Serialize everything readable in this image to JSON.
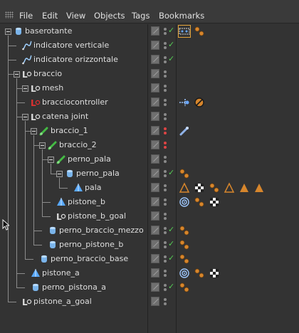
{
  "menubar": {
    "items": [
      {
        "id": "file",
        "label": "File"
      },
      {
        "id": "edit",
        "label": "Edit"
      },
      {
        "id": "view",
        "label": "View"
      },
      {
        "id": "objects",
        "label": "Objects"
      },
      {
        "id": "tags",
        "label": "Tags"
      },
      {
        "id": "bookmarks",
        "label": "Bookmarks"
      }
    ]
  },
  "objects": [
    {
      "name": "baserotante",
      "icon": "cylinder-icon",
      "tags": [
        "rig-tag-icon",
        "material-tag-icon"
      ]
    },
    {
      "name": "indicatore verticale",
      "icon": "spline-icon",
      "tags": []
    },
    {
      "name": "indicatore orizzontale",
      "icon": "spline-icon",
      "tags": []
    },
    {
      "name": "braccio",
      "icon": "null-icon",
      "tags": []
    },
    {
      "name": "mesh",
      "icon": "null-icon",
      "tags": []
    },
    {
      "name": "bracciocontroller",
      "icon": "null-controller-icon",
      "tags": [
        "constraint-tag-icon",
        "stop-tag-icon"
      ]
    },
    {
      "name": "catena joint",
      "icon": "null-icon",
      "tags": []
    },
    {
      "name": "braccio_1",
      "icon": "joint-icon",
      "tags": [
        "ik-tag-icon"
      ]
    },
    {
      "name": "braccio_2",
      "icon": "joint-icon",
      "tags": []
    },
    {
      "name": "perno_pala",
      "icon": "joint-icon",
      "tags": []
    },
    {
      "name": "perno_pala",
      "icon": "cylinder-icon",
      "tags": [
        "material-tag-icon"
      ]
    },
    {
      "name": "pala",
      "icon": "polygon-icon",
      "tags": [
        "phong-tag-icon",
        "checker-tag-icon",
        "material-tag-icon",
        "phong-tag-icon",
        "filled-triangle-tag-icon",
        "filled-triangle-tag-icon"
      ]
    },
    {
      "name": "pistone_b",
      "icon": "polygon-icon",
      "tags": [
        "target-tag-icon",
        "material-tag-icon",
        "checker-tag-icon"
      ]
    },
    {
      "name": "pistone_b_goal",
      "icon": "null-icon",
      "tags": []
    },
    {
      "name": "perno_braccio_mezzo",
      "icon": "cylinder-icon",
      "tags": [
        "material-tag-icon"
      ]
    },
    {
      "name": "perno_pistone_b",
      "icon": "cylinder-icon",
      "tags": [
        "material-tag-icon"
      ]
    },
    {
      "name": "perno_braccio_base",
      "icon": "cylinder-icon",
      "tags": [
        "material-tag-icon"
      ]
    },
    {
      "name": "pistone_a",
      "icon": "polygon-icon",
      "tags": [
        "target-tag-icon",
        "material-tag-icon",
        "checker-tag-icon"
      ]
    },
    {
      "name": "perno_pistona_a",
      "icon": "cylinder-icon",
      "tags": [
        "material-tag-icon"
      ]
    },
    {
      "name": "pistone_a_goal",
      "icon": "null-icon",
      "tags": []
    }
  ],
  "colors": {
    "background": "#333333",
    "text": "#dedede",
    "check": "#55cc55",
    "tag_orange": "#d7862c",
    "joint": "#44bb44",
    "null": "#dcdcdc",
    "null_controller": "#e03030",
    "cylinder": "#7ab4ea",
    "polygon": "#59a9ff",
    "selection": "#e5a53a"
  }
}
